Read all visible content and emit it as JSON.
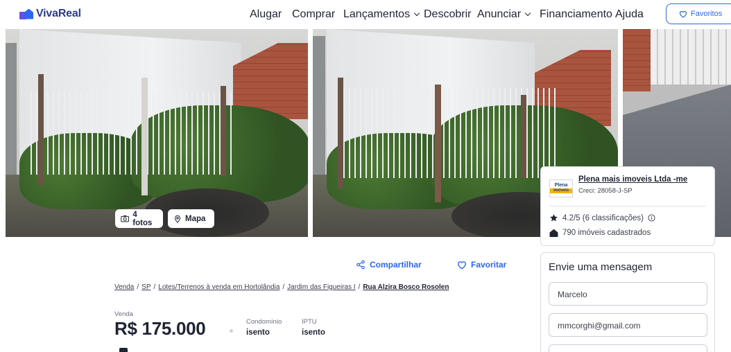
{
  "header": {
    "logo_text": "VivaReal",
    "nav": [
      {
        "label": "Alugar",
        "has_dropdown": false
      },
      {
        "label": "Comprar",
        "has_dropdown": false
      },
      {
        "label": "Lançamentos",
        "has_dropdown": true
      },
      {
        "label": "Descobrir",
        "has_dropdown": false
      },
      {
        "label": "Anunciar",
        "has_dropdown": true
      },
      {
        "label": "Financiamento",
        "has_dropdown": false
      },
      {
        "label": "Ajuda",
        "has_dropdown": false
      }
    ],
    "favorites_label": "Favoritos"
  },
  "gallery": {
    "photos_button": "4 fotos",
    "map_button": "Mapa"
  },
  "agent": {
    "logo_text": "Plena",
    "logo_sub": "imóveis",
    "name": "Plena mais imoveis Ltda -me",
    "creci": "Creci: 28058-J-SP",
    "rating": "4.2/5 (6 classificações)",
    "listings": "790 imóveis cadastrados"
  },
  "message": {
    "title": "Envie uma mensagem",
    "name_value": "Marcelo",
    "email_value": "mmcorghi@gmail.com"
  },
  "actions": {
    "share": "Compartilhar",
    "favorite": "Favoritar"
  },
  "breadcrumb": [
    "Venda",
    "SP",
    "Lotes/Terrenos à venda em Hortolândia",
    "Jardim das Figueiras I",
    "Rua Alzira Bosco Rosolen"
  ],
  "listing": {
    "price_label": "Venda",
    "price": "R$ 175.000",
    "condo_label": "Condomínio",
    "condo_value": "isento",
    "iptu_label": "IPTU",
    "iptu_value": "isento"
  },
  "colors": {
    "brand": "#2c66f5",
    "text": "#1f2433"
  }
}
